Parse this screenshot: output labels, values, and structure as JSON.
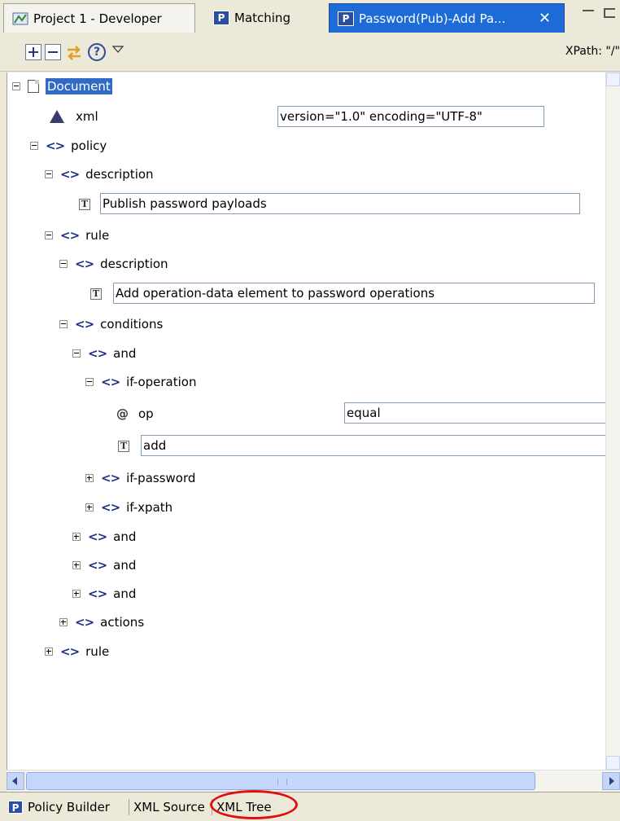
{
  "tabs": [
    {
      "label": "Project 1 - Developer",
      "icon": "project-icon"
    },
    {
      "label": "Matching",
      "icon": "policy-icon"
    },
    {
      "label": "Password(Pub)-Add Pa...",
      "icon": "policy-icon",
      "active": true,
      "close": "✕"
    }
  ],
  "toolbar": {
    "xpath_label": "XPath: \"/\""
  },
  "tree": {
    "document": "Document",
    "xml_decl": {
      "label": "xml",
      "value": "version=\"1.0\" encoding=\"UTF-8\""
    },
    "policy": "policy",
    "policy_description": "description",
    "policy_description_text": "Publish password payloads",
    "rule1": "rule",
    "rule1_description": "description",
    "rule1_description_text": "Add operation-data element to password operations",
    "conditions": "conditions",
    "and1": "and",
    "if_operation": "if-operation",
    "attr_op": {
      "label": "op",
      "value": "equal"
    },
    "if_operation_text": "add",
    "if_password": "if-password",
    "if_xpath": "if-xpath",
    "and2": "and",
    "and3": "and",
    "and4": "and",
    "actions": "actions",
    "rule2": "rule"
  },
  "bottom_tabs": [
    "Policy Builder",
    "XML Source",
    "XML Tree"
  ],
  "colors": {
    "active_tab": "#1c6bd6",
    "selection": "#316ac5",
    "highlight_oval": "#e01010"
  }
}
